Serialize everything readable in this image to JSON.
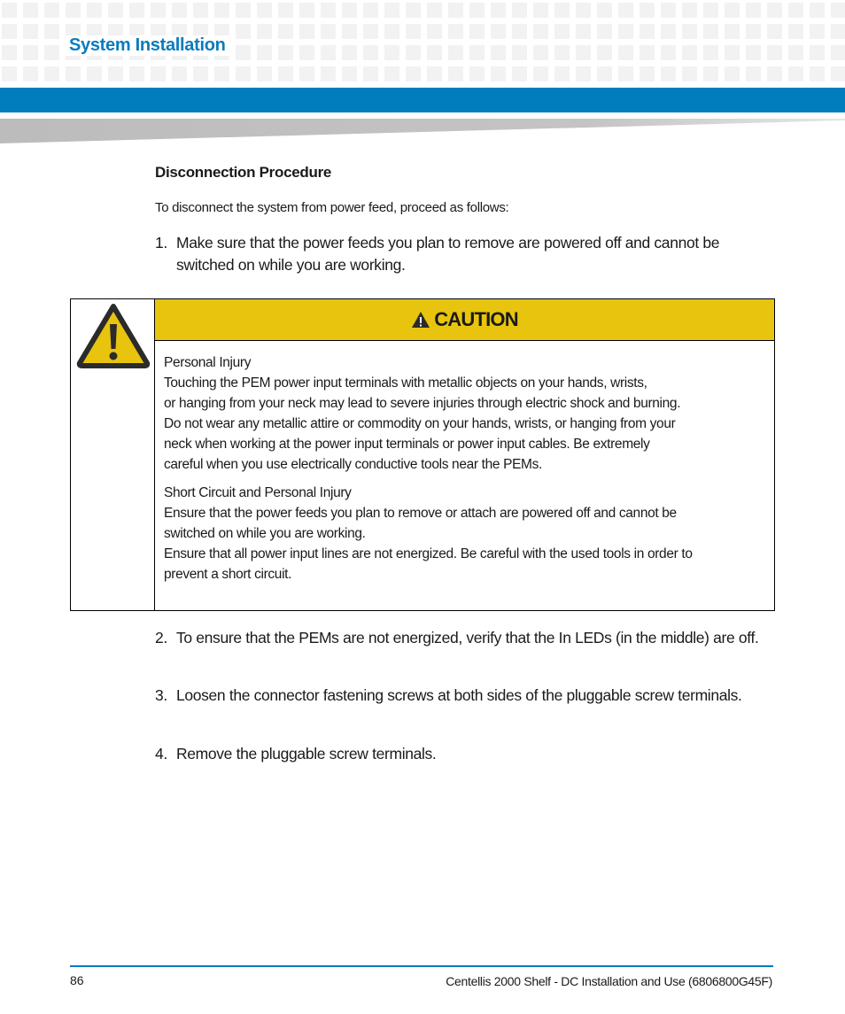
{
  "header": {
    "section_title": "System Installation",
    "brand_color": "#007dbd"
  },
  "content": {
    "subheading": "Disconnection Procedure",
    "intro": "To disconnect the system from power feed, proceed as follows:",
    "steps": [
      {
        "num": "1.",
        "text": "Make sure that the power feeds you plan to remove are powered off and cannot be switched on while you are working."
      },
      {
        "num": "2.",
        "text": "To ensure that the PEMs are not energized, verify that the In LEDs (in the middle) are off."
      },
      {
        "num": "3.",
        "text": "Loosen the connector fastening screws at both sides of the pluggable screw terminals."
      },
      {
        "num": "4.",
        "text": "Remove the pluggable screw terminals."
      }
    ]
  },
  "caution": {
    "icon": "warning-triangle-icon",
    "banner_label": "CAUTION",
    "banner_color": "#e8c40e",
    "blocks": [
      {
        "title": "Personal Injury",
        "lines": [
          "Touching the PEM power input terminals with metallic objects on your hands, wrists,",
          "or hanging from your neck may lead to severe injuries through electric shock and burning.",
          "Do not wear any metallic attire or commodity on your hands, wrists, or hanging from your",
          "neck when working at the power input terminals or power input cables. Be extremely",
          "careful when you use electrically conductive tools near the PEMs."
        ]
      },
      {
        "title": "Short Circuit and Personal Injury",
        "lines": [
          "Ensure that the power feeds you plan to remove or attach are powered off and cannot be",
          "switched on while you are working.",
          "Ensure that all power input lines are not energized. Be careful with the used tools in order to",
          "prevent a short circuit."
        ]
      }
    ]
  },
  "footer": {
    "page_number": "86",
    "doc_title": "Centellis 2000 Shelf - DC Installation and Use (6806800G45F)"
  }
}
